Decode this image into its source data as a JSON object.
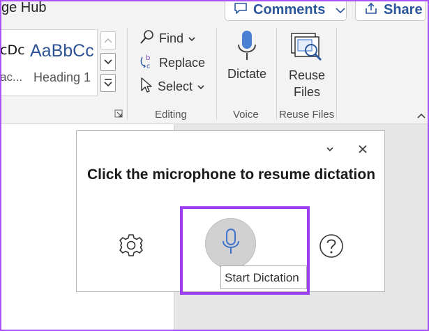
{
  "header": {
    "title_fragment": "ge Hub",
    "comments_label": "Comments",
    "share_label": "Share"
  },
  "styles_gallery": {
    "style1_sample": "cDc",
    "style1_name": "ac...",
    "style2_sample": "AaBbCc",
    "style2_name": "Heading 1"
  },
  "editing": {
    "find_label": "Find",
    "replace_label": "Replace",
    "select_label": "Select",
    "group_label": "Editing"
  },
  "voice": {
    "dictate_label": "Dictate",
    "group_label": "Voice"
  },
  "reuse": {
    "label_line1": "Reuse",
    "label_line2": "Files",
    "group_label": "Reuse Files"
  },
  "dictation_panel": {
    "title": "Click the microphone to resume dictation",
    "tooltip": "Start Dictation"
  },
  "colors": {
    "accent_blue": "#2b579a",
    "highlight_purple": "#9b3ff0",
    "mic_blue": "#4a7fd4"
  }
}
